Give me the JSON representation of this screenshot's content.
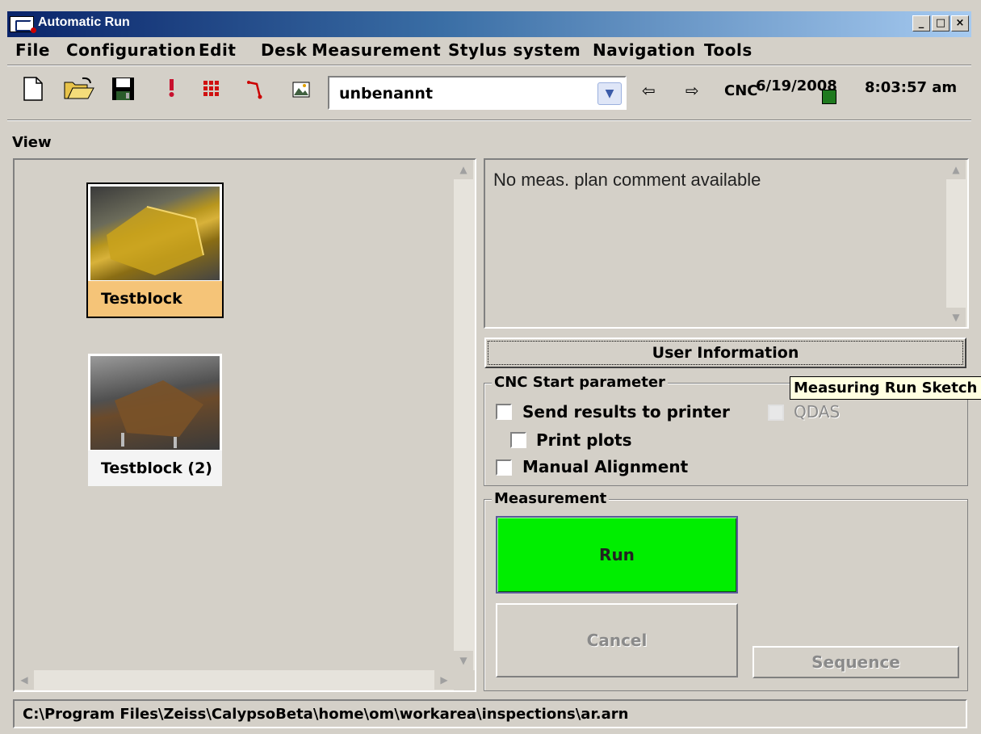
{
  "window": {
    "title": "Automatic Run"
  },
  "menu": [
    "File",
    "Configuration",
    "Edit",
    "Desk",
    "Measurement",
    "Stylus system",
    "Navigation",
    "Tools"
  ],
  "toolbar": {
    "plan_combo_value": "unbenannt",
    "cnc_label": "CNC",
    "date": "6/19/2008",
    "time": "8:03:57 am"
  },
  "view": {
    "label": "View",
    "items": [
      {
        "name": "Testblock",
        "selected": true
      },
      {
        "name": "Testblock (2)",
        "selected": false
      }
    ]
  },
  "comment": {
    "text": "No meas. plan comment available"
  },
  "buttons": {
    "user_info": "User Information",
    "run": "Run",
    "cancel": "Cancel",
    "sequence": "Sequence"
  },
  "cnc_params": {
    "title": "CNC Start parameter",
    "send_results": "Send results to printer",
    "qdas": "QDAS",
    "print_plots": "Print plots",
    "manual_alignment": "Manual Alignment"
  },
  "measurement": {
    "title": "Measurement"
  },
  "tooltip": "Measuring Run Sketch",
  "status": {
    "path": "C:\\Program Files\\Zeiss\\CalypsoBeta\\home\\om\\workarea\\inspections\\ar.arn"
  },
  "colors": {
    "run_green": "#00ee00",
    "selected_caption": "#f5c478",
    "titlebar": "#0a246a"
  }
}
